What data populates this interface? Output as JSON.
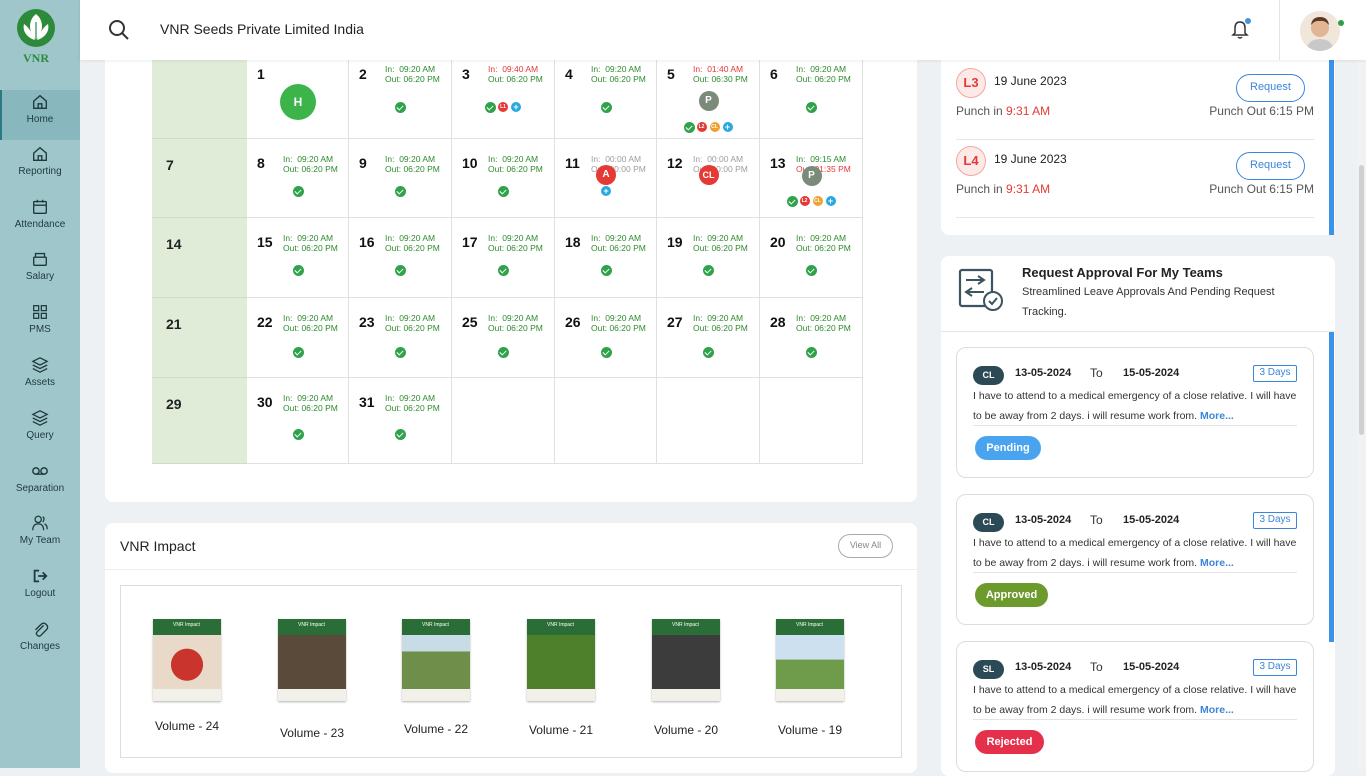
{
  "header": {
    "company": "VNR Seeds Private Limited India"
  },
  "sidebar": {
    "logo_text": "VNR",
    "items": [
      {
        "label": "Home",
        "icon": "home-icon"
      },
      {
        "label": "Reporting",
        "icon": "home-icon"
      },
      {
        "label": "Attendance",
        "icon": "calendar-icon"
      },
      {
        "label": "Salary",
        "icon": "wallet-icon"
      },
      {
        "label": "PMS",
        "icon": "grid-icon"
      },
      {
        "label": "Assets",
        "icon": "layers-icon"
      },
      {
        "label": "Query",
        "icon": "layers-icon"
      },
      {
        "label": "Separation",
        "icon": "voicemail-icon"
      },
      {
        "label": "My Team",
        "icon": "users-icon"
      },
      {
        "label": "Logout",
        "icon": "logout-icon"
      },
      {
        "label": "Changes",
        "icon": "paperclip-icon"
      }
    ]
  },
  "calendar": {
    "weeks": [
      "",
      "7",
      "14",
      "21",
      "29"
    ],
    "days": [
      {
        "day": "1",
        "badge": "H",
        "badge_color": "#3cb44a"
      },
      {
        "day": "2",
        "in": "09:20 AM",
        "out": "06:20 PM",
        "ok": true
      },
      {
        "day": "3",
        "in": "09:40 AM",
        "out": "06:20 PM",
        "in_color": "red",
        "ok": true,
        "minis": [
          {
            "t": "L1",
            "c": "#e53935"
          },
          {
            "t": "+",
            "c": "#29a8e0"
          }
        ]
      },
      {
        "day": "4",
        "in": "09:20 AM",
        "out": "06:20 PM",
        "ok": true
      },
      {
        "day": "5",
        "in": "01:40 AM",
        "out": "06:30 PM",
        "in_color": "red",
        "badge": "P",
        "badge_color": "#7b8a7b",
        "ok": true,
        "minis": [
          {
            "t": "L2",
            "c": "#e53935"
          },
          {
            "t": "CL",
            "c": "#f0a030"
          },
          {
            "t": "+",
            "c": "#29a8e0"
          }
        ]
      },
      {
        "day": "6",
        "in": "09:20 AM",
        "out": "06:20 PM",
        "ok": true
      },
      {
        "day": "8",
        "in": "09:20 AM",
        "out": "06:20 PM",
        "ok": true
      },
      {
        "day": "9",
        "in": "09:20 AM",
        "out": "06:20 PM",
        "ok": true
      },
      {
        "day": "10",
        "in": "09:20 AM",
        "out": "06:20 PM",
        "ok": true
      },
      {
        "day": "11",
        "in": "00:00 AM",
        "out": "00:00 PM",
        "grey": true,
        "badge": "A",
        "badge_color": "#e53935",
        "minis": [
          {
            "t": "+",
            "c": "#29a8e0"
          }
        ]
      },
      {
        "day": "12",
        "in": "00:00 AM",
        "out": "00:00 PM",
        "grey": true,
        "badge": "CL",
        "badge_color": "#e53935"
      },
      {
        "day": "13",
        "in": "09:15 AM",
        "out": "01:35 PM",
        "out_color": "red",
        "badge": "P",
        "badge_color": "#7b8a7b",
        "ok": true,
        "minis": [
          {
            "t": "L2",
            "c": "#e53935"
          },
          {
            "t": "CL",
            "c": "#f0a030"
          },
          {
            "t": "+",
            "c": "#29a8e0"
          }
        ]
      },
      {
        "day": "15",
        "in": "09:20 AM",
        "out": "06:20 PM",
        "ok": true
      },
      {
        "day": "16",
        "in": "09:20 AM",
        "out": "06:20 PM",
        "ok": true
      },
      {
        "day": "17",
        "in": "09:20 AM",
        "out": "06:20 PM",
        "ok": true
      },
      {
        "day": "18",
        "in": "09:20 AM",
        "out": "06:20 PM",
        "ok": true
      },
      {
        "day": "19",
        "in": "09:20 AM",
        "out": "06:20 PM",
        "ok": true
      },
      {
        "day": "20",
        "in": "09:20 AM",
        "out": "06:20 PM",
        "ok": true
      },
      {
        "day": "22",
        "in": "09:20 AM",
        "out": "06:20 PM",
        "ok": true
      },
      {
        "day": "23",
        "in": "09:20 AM",
        "out": "06:20 PM",
        "ok": true
      },
      {
        "day": "25",
        "in": "09:20 AM",
        "out": "06:20 PM",
        "ok": true
      },
      {
        "day": "26",
        "in": "09:20 AM",
        "out": "06:20 PM",
        "ok": true
      },
      {
        "day": "27",
        "in": "09:20 AM",
        "out": "06:20 PM",
        "ok": true
      },
      {
        "day": "28",
        "in": "09:20 AM",
        "out": "06:20 PM",
        "ok": true
      },
      {
        "day": "30",
        "in": "09:20 AM",
        "out": "06:20 PM",
        "ok": true
      },
      {
        "day": "31",
        "in": "09:20 AM",
        "out": "06:20 PM",
        "ok": true
      },
      {
        "day": ""
      },
      {
        "day": ""
      },
      {
        "day": ""
      },
      {
        "day": ""
      }
    ],
    "in_label": "In:",
    "out_label": "Out:"
  },
  "impact": {
    "title": "VNR Impact",
    "view_all": "View All",
    "cover_label": "VNR Impact",
    "volumes": [
      {
        "label": "Volume - 24",
        "color": "#b5413a"
      },
      {
        "label": "Volume - 23",
        "color": "#5a4a3a"
      },
      {
        "label": "Volume - 22",
        "color": "#6f8e4a"
      },
      {
        "label": "Volume - 21",
        "color": "#4e7f2a"
      },
      {
        "label": "Volume - 20",
        "color": "#3c3c3c"
      },
      {
        "label": "Volume - 19",
        "color": "#7aa76a"
      }
    ]
  },
  "punch": [
    {
      "level": "L3",
      "date": "19 June 2023",
      "request": "Request",
      "in_label": "Punch in",
      "in_time": "9:31 AM",
      "out": "Punch Out 6:15 PM"
    },
    {
      "level": "L4",
      "date": "19 June 2023",
      "request": "Request",
      "in_label": "Punch in",
      "in_time": "9:31 AM",
      "out": "Punch Out 6:15 PM"
    }
  ],
  "approval": {
    "title": "Request Approval For My Teams",
    "subtitle": "Streamlined Leave Approvals And Pending Request Tracking.",
    "to_label": "To",
    "more": "More...",
    "items": [
      {
        "type": "CL",
        "from": "13-05-2024",
        "to": "15-05-2024",
        "days": "3 Days",
        "text": "I have to attend to a medical emergency of a close relative. I will have to be away from 2 days. i will resume work from.",
        "status": "Pending",
        "status_color": "#4aa3ef"
      },
      {
        "type": "CL",
        "from": "13-05-2024",
        "to": "15-05-2024",
        "days": "3 Days",
        "text": "I have to attend to a medical emergency of a close relative. I will have to be away from 2 days. i will resume work from.",
        "status": "Approved",
        "status_color": "#6c9a2c"
      },
      {
        "type": "SL",
        "from": "13-05-2024",
        "to": "15-05-2024",
        "days": "3 Days",
        "text": "I have to attend to a medical emergency of a close relative. I will have to be away from 2 days. i will resume work from.",
        "status": "Rejected",
        "status_color": "#e5304b"
      }
    ]
  }
}
